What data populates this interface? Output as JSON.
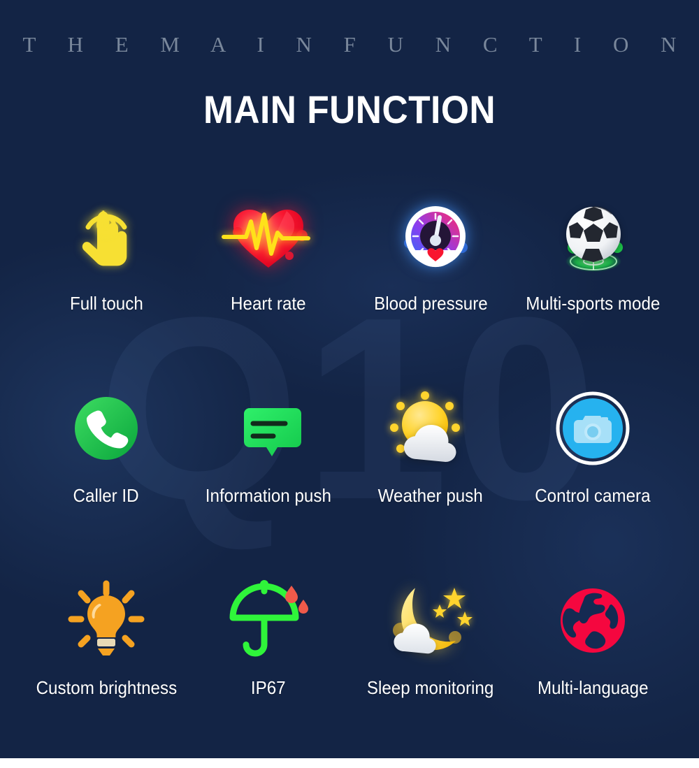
{
  "header": {
    "eyebrow": "T H E   M A I N   F U N C T I O N",
    "title": "MAIN FUNCTION"
  },
  "watermark": {
    "text": "Q10"
  },
  "colors": {
    "background_top": "#101c33",
    "background_bottom": "#15294f",
    "eyebrow": "#79879b",
    "title": "#ffffff",
    "label": "#ffffff",
    "touch_yellow": "#f7e033",
    "heart_red": "#f8152f",
    "pulse_yellow": "#ffe11a",
    "gauge_blue": "#2f6df6",
    "gauge_pink": "#ff2a6a",
    "sports_green": "#1fd84a",
    "caller_green": "#1fc44a",
    "message_green": "#21d75a",
    "weather_yellow": "#ffd42e",
    "camera_blue": "#26b2ef",
    "bulb_orange": "#f5a221",
    "ip67_green": "#2ff53a",
    "droplet_red": "#ef5a4a",
    "moon_yellow": "#ffd84a",
    "globe_red": "#f5073f"
  },
  "features": [
    {
      "label": "Full touch",
      "icon": "touch-hand-icon"
    },
    {
      "label": "Heart rate",
      "icon": "heart-pulse-icon"
    },
    {
      "label": "Blood pressure",
      "icon": "pressure-gauge-icon"
    },
    {
      "label": "Multi-sports mode",
      "icon": "soccer-ball-icon"
    },
    {
      "label": "Caller ID",
      "icon": "phone-call-icon"
    },
    {
      "label": "Information push",
      "icon": "message-bubble-icon"
    },
    {
      "label": "Weather push",
      "icon": "sun-cloud-icon"
    },
    {
      "label": "Control camera",
      "icon": "camera-icon"
    },
    {
      "label": "Custom brightness",
      "icon": "light-bulb-icon"
    },
    {
      "label": "IP67",
      "icon": "umbrella-water-icon"
    },
    {
      "label": "Sleep monitoring",
      "icon": "moon-stars-icon"
    },
    {
      "label": "Multi-language",
      "icon": "globe-icon"
    }
  ]
}
